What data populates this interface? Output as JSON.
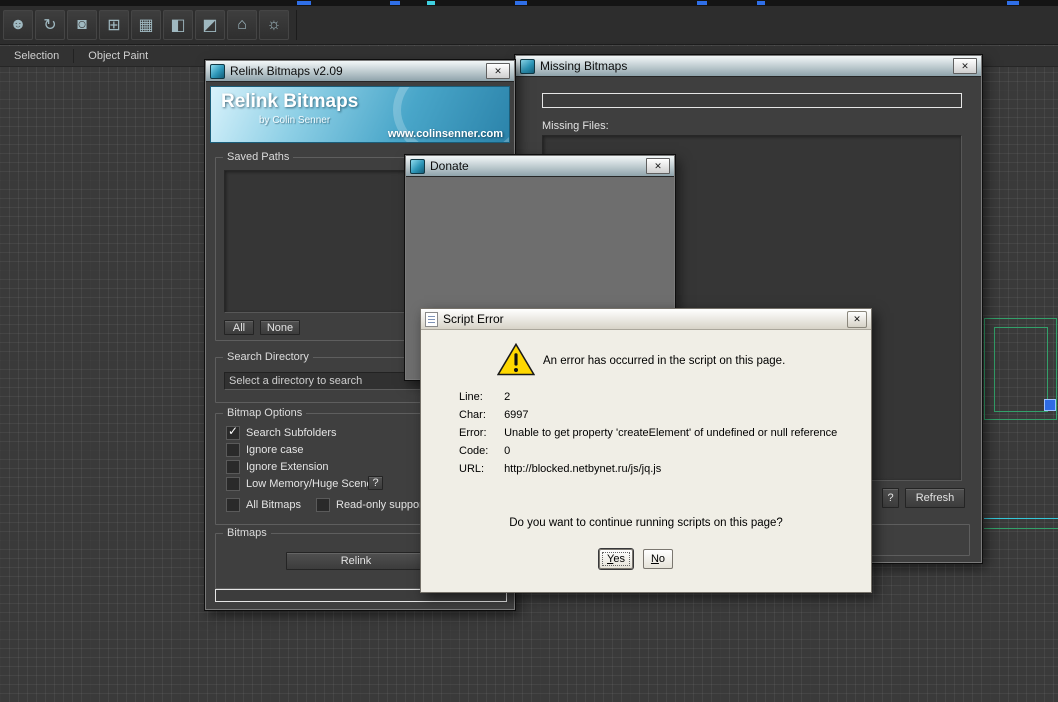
{
  "ui": {
    "close_glyph": "✕"
  },
  "colors": {
    "accent_teal": "#2d96b8",
    "warning_yellow": "#ffd800",
    "wire_green": "#33a06a",
    "wire_cyan": "#35c8d8",
    "selection_blue": "#2e6be4"
  },
  "toolbar": {
    "icons": [
      {
        "name": "character-icon",
        "glyph": "☻"
      },
      {
        "name": "rotate-icon",
        "glyph": "↻"
      },
      {
        "name": "layers-icon",
        "glyph": "◙"
      },
      {
        "name": "transform-icon",
        "glyph": "⊞"
      },
      {
        "name": "array-icon",
        "glyph": "▦"
      },
      {
        "name": "mirror-icon",
        "glyph": "◧"
      },
      {
        "name": "camera-icon",
        "glyph": "◩"
      },
      {
        "name": "scene-icon",
        "glyph": "⌂"
      },
      {
        "name": "light-icon",
        "glyph": "☼"
      }
    ]
  },
  "ribbon": {
    "tabs": [
      {
        "label": "Selection"
      },
      {
        "label": "Object Paint"
      }
    ]
  },
  "relink_dialog": {
    "title": "Relink Bitmaps v2.09",
    "banner": {
      "title": "Relink Bitmaps",
      "byline": "by Colin Senner",
      "website": "www.colinsenner.com"
    },
    "saved_paths": {
      "label": "Saved Paths",
      "all_button": "All",
      "none_button": "None"
    },
    "search_directory": {
      "label": "Search Directory",
      "value": "Select a directory to search"
    },
    "bitmap_options": {
      "label": "Bitmap Options",
      "help_button": "?",
      "checkboxes": [
        {
          "label": "Search Subfolders",
          "checked": true
        },
        {
          "label": "Ignore case",
          "checked": false
        },
        {
          "label": "Ignore Extension",
          "checked": false
        },
        {
          "label": "Low Memory/Huge Scene",
          "checked": false
        },
        {
          "label": "All Bitmaps",
          "checked": false
        },
        {
          "label": "Read-only support",
          "checked": false
        }
      ]
    },
    "bitmaps_group": {
      "label": "Bitmaps",
      "relink_button": "Relink"
    }
  },
  "missing_bitmaps_dialog": {
    "title": "Missing Bitmaps",
    "missing_files_label": "Missing Files:",
    "help_button": "?",
    "refresh_button": "Refresh"
  },
  "donate_dialog": {
    "title": "Donate"
  },
  "script_error_dialog": {
    "title": "Script Error",
    "message": "An error has occurred in the script on this page.",
    "fields": [
      {
        "label": "Line:",
        "value": "2"
      },
      {
        "label": "Char:",
        "value": "6997"
      },
      {
        "label": "Error:",
        "value": "Unable to get property 'createElement' of undefined or null reference"
      },
      {
        "label": "Code:",
        "value": "0"
      },
      {
        "label": "URL:",
        "value": "http://blocked.netbynet.ru/js/jq.js"
      }
    ],
    "question": "Do you want to continue running scripts on this page?",
    "yes_button": "Yes",
    "no_button": "No"
  }
}
